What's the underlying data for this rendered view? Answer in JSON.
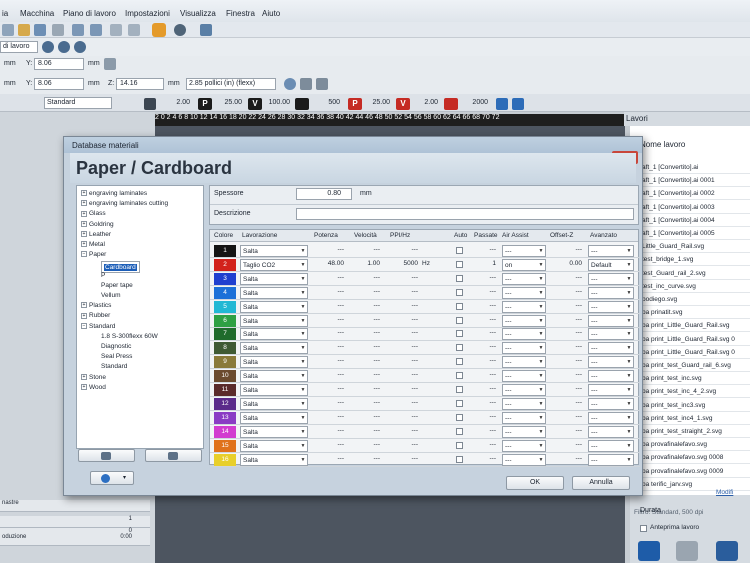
{
  "menu": [
    "ia",
    "Macchina",
    "Piano di lavoro",
    "Impostazioni",
    "Visualizza",
    "Finestra",
    "Aiuto"
  ],
  "toolbar": {
    "work_area_label": "di lavoro"
  },
  "position": {
    "y1_label": "Y:",
    "y1_value": "8.06",
    "y1_unit": "mm",
    "x_unit": "mm",
    "x_label": "Y:",
    "x_value": "8.06",
    "x_unit2": "mm",
    "z_label": "Z:",
    "z_value": "14.16",
    "z_unit": "mm",
    "lens": "2.85 pollici (in) (flexx)"
  },
  "params": {
    "mode": "Standard",
    "v1": "2.00",
    "p_label": "P",
    "p_value": "25.00",
    "v_label": "V",
    "v_value": "100.00",
    "freq_value": "500",
    "p2_value": "25.00",
    "v2_value": "2.00",
    "f2_value": "2000"
  },
  "ruler": "2 0 2 4 6 8 10 12 14 16 18 20 22 24 26 28 30 32 34 36 38 40 42 44 46 48 50 52 54 56 58 60 62 64 66 68 70 72",
  "right_panel": {
    "title": "Lavori",
    "header": "Nome lavoro",
    "items": [
      "aft_1 [Convertito].ai",
      "aft_1 [Convertito].ai 0001",
      "aft_1 [Convertito].ai 0002",
      "aft_1 [Convertito].ai 0003",
      "aft_1 [Convertito].ai 0004",
      "aft_1 [Convertito].ai 0005",
      "Little_Guard_Rail.svg",
      "test_bridge_1.svg",
      "test_Guard_rail_2.svg",
      "test_inc_curve.svg",
      "podiego.svg",
      "pa prinatit.svg",
      "pa print_Little_Guard_Rail.svg",
      "pa print_Little_Guard_Rail.svg 0",
      "pa print_Little_Guard_Rail.svg 0",
      "pa print_test_Guard_rail_6.svg",
      "pa print_test_inc.svg",
      "pa print_test_inc_4_2.svg",
      "pa print_test_inc3.svg",
      "pa print_test_inc4_1.svg",
      "pa print_test_straight_2.svg",
      "pa provafinalefavo.svg",
      "pa provafinalefavo.svg 0008",
      "pa provafinalefavo.svg 0009",
      "pa terific_jarv.svg"
    ],
    "filter": "Filtro: Standard, 500 dpi",
    "modify": "Modifi",
    "duration": "Durata",
    "preview": "Anteprima lavoro"
  },
  "left_panel": {
    "rows": [
      {
        "label": "nastre",
        "value": ""
      },
      {
        "label": "",
        "value": "1"
      },
      {
        "label": "",
        "value": "0"
      },
      {
        "label": "oduzione",
        "value": "0:00"
      }
    ]
  },
  "dialog": {
    "title": "Database materiali",
    "heading": "Paper / Cardboard",
    "close": "X",
    "tree": [
      {
        "label": "engraving laminates",
        "expander": "+",
        "level": 0
      },
      {
        "label": "engraving laminates cutting",
        "expander": "+",
        "level": 0
      },
      {
        "label": "Glass",
        "expander": "+",
        "level": 0
      },
      {
        "label": "Goldring",
        "expander": "+",
        "level": 0
      },
      {
        "label": "Leather",
        "expander": "+",
        "level": 0
      },
      {
        "label": "Metal",
        "expander": "+",
        "level": 0
      },
      {
        "label": "Paper",
        "expander": "−",
        "level": 0
      },
      {
        "label": "Cardboard",
        "expander": "",
        "level": 1,
        "selected": true
      },
      {
        "label": "P",
        "expander": "",
        "level": 1
      },
      {
        "label": "Paper tape",
        "expander": "",
        "level": 1
      },
      {
        "label": "Vellum",
        "expander": "",
        "level": 1
      },
      {
        "label": "Plastics",
        "expander": "+",
        "level": 0
      },
      {
        "label": "Rubber",
        "expander": "+",
        "level": 0
      },
      {
        "label": "Standard",
        "expander": "−",
        "level": 0
      },
      {
        "label": "1.8 S-300flexx 60W",
        "expander": "",
        "level": 1
      },
      {
        "label": "Diagnostic",
        "expander": "",
        "level": 1
      },
      {
        "label": "Seal Press",
        "expander": "",
        "level": 1
      },
      {
        "label": "Standard",
        "expander": "",
        "level": 1
      },
      {
        "label": "Stone",
        "expander": "+",
        "level": 0
      },
      {
        "label": "Wood",
        "expander": "+",
        "level": 0
      }
    ],
    "thickness_label": "Spessore",
    "thickness_value": "0.80",
    "thickness_unit": "mm",
    "description_label": "Descrizione",
    "columns": [
      "Colore",
      "Lavorazione",
      "Potenza",
      "Velocità",
      "PPI/Hz",
      "Auto",
      "Passate",
      "Air Assist",
      "Offset-Z",
      "Avanzato"
    ],
    "rows": [
      {
        "num": "1",
        "color": "#141414",
        "op": "Salta",
        "power": "---",
        "speed": "---",
        "ppi": "---",
        "unit": "",
        "passes": "---",
        "air": "---",
        "offset": "---",
        "adv": "---"
      },
      {
        "num": "2",
        "color": "#d2221c",
        "op": "Taglio CO2",
        "power": "48.00",
        "speed": "1.00",
        "ppi": "5000",
        "unit": "Hz",
        "passes": "1",
        "air": "on",
        "offset": "0.00",
        "adv": "Default"
      },
      {
        "num": "3",
        "color": "#1f3fcf",
        "op": "Salta",
        "power": "---",
        "speed": "---",
        "ppi": "---",
        "unit": "",
        "passes": "---",
        "air": "---",
        "offset": "---",
        "adv": "---"
      },
      {
        "num": "4",
        "color": "#1c70d8",
        "op": "Salta",
        "power": "---",
        "speed": "---",
        "ppi": "---",
        "unit": "",
        "passes": "---",
        "air": "---",
        "offset": "---",
        "adv": "---"
      },
      {
        "num": "5",
        "color": "#22b8d4",
        "op": "Salta",
        "power": "---",
        "speed": "---",
        "ppi": "---",
        "unit": "",
        "passes": "---",
        "air": "---",
        "offset": "---",
        "adv": "---"
      },
      {
        "num": "6",
        "color": "#2ea043",
        "op": "Salta",
        "power": "---",
        "speed": "---",
        "ppi": "---",
        "unit": "",
        "passes": "---",
        "air": "---",
        "offset": "---",
        "adv": "---"
      },
      {
        "num": "7",
        "color": "#1f6b2c",
        "op": "Salta",
        "power": "---",
        "speed": "---",
        "ppi": "---",
        "unit": "",
        "passes": "---",
        "air": "---",
        "offset": "---",
        "adv": "---"
      },
      {
        "num": "8",
        "color": "#3f5a34",
        "op": "Salta",
        "power": "---",
        "speed": "---",
        "ppi": "---",
        "unit": "",
        "passes": "---",
        "air": "---",
        "offset": "---",
        "adv": "---"
      },
      {
        "num": "9",
        "color": "#8a7a3a",
        "op": "Salta",
        "power": "---",
        "speed": "---",
        "ppi": "---",
        "unit": "",
        "passes": "---",
        "air": "---",
        "offset": "---",
        "adv": "---"
      },
      {
        "num": "10",
        "color": "#6b4a2e",
        "op": "Salta",
        "power": "---",
        "speed": "---",
        "ppi": "---",
        "unit": "",
        "passes": "---",
        "air": "---",
        "offset": "---",
        "adv": "---"
      },
      {
        "num": "11",
        "color": "#5a2a2a",
        "op": "Salta",
        "power": "---",
        "speed": "---",
        "ppi": "---",
        "unit": "",
        "passes": "---",
        "air": "---",
        "offset": "---",
        "adv": "---"
      },
      {
        "num": "12",
        "color": "#5a2a8a",
        "op": "Salta",
        "power": "---",
        "speed": "---",
        "ppi": "---",
        "unit": "",
        "passes": "---",
        "air": "---",
        "offset": "---",
        "adv": "---"
      },
      {
        "num": "13",
        "color": "#8a3bc4",
        "op": "Salta",
        "power": "---",
        "speed": "---",
        "ppi": "---",
        "unit": "",
        "passes": "---",
        "air": "---",
        "offset": "---",
        "adv": "---"
      },
      {
        "num": "14",
        "color": "#d23bd0",
        "op": "Salta",
        "power": "---",
        "speed": "---",
        "ppi": "---",
        "unit": "",
        "passes": "---",
        "air": "---",
        "offset": "---",
        "adv": "---"
      },
      {
        "num": "15",
        "color": "#e0721c",
        "op": "Salta",
        "power": "---",
        "speed": "---",
        "ppi": "---",
        "unit": "",
        "passes": "---",
        "air": "---",
        "offset": "---",
        "adv": "---"
      },
      {
        "num": "16",
        "color": "#e8cf2a",
        "op": "Salta",
        "power": "---",
        "speed": "---",
        "ppi": "---",
        "unit": "",
        "passes": "---",
        "air": "---",
        "offset": "---",
        "adv": "---"
      }
    ],
    "ok": "OK",
    "cancel": "Annulla"
  }
}
